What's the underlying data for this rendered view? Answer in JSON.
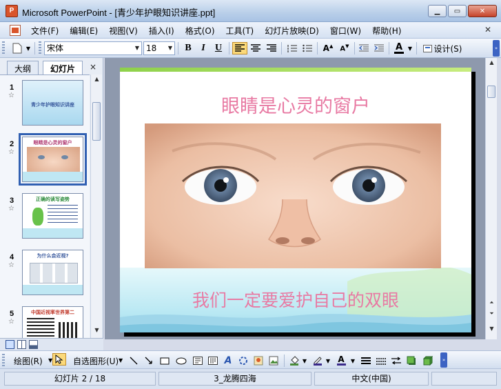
{
  "window": {
    "title": "Microsoft PowerPoint - [青少年护眼知识讲座.ppt]",
    "app_icon": "P"
  },
  "menubar": {
    "items": [
      "文件(F)",
      "编辑(E)",
      "视图(V)",
      "插入(I)",
      "格式(O)",
      "工具(T)",
      "幻灯片放映(D)",
      "窗口(W)",
      "帮助(H)"
    ]
  },
  "toolbar": {
    "font_name": "宋体",
    "font_size": "18",
    "bold": "B",
    "italic": "I",
    "underline": "U",
    "design_label": "设计(S)"
  },
  "leftpanel": {
    "tabs": [
      "大纲",
      "幻灯片"
    ],
    "close": "×",
    "thumbnails": [
      {
        "number": "1",
        "caption": "青少年护眼知识讲座"
      },
      {
        "number": "2",
        "caption": "眼睛是心灵的窗户"
      },
      {
        "number": "3",
        "caption": "正确的读写姿势"
      },
      {
        "number": "4",
        "caption": "为什么会近视?"
      },
      {
        "number": "5",
        "caption": "中国近视率世界第二"
      }
    ]
  },
  "slide": {
    "title": "眼睛是心灵的窗户",
    "subtitle": "我们一定要爱护自己的双眼"
  },
  "drawbar": {
    "draw_label": "绘图(R)",
    "autoshapes_label": "自选图形(U)"
  },
  "statusbar": {
    "slide_info": "幻灯片 2 / 18",
    "design_name": "3_龙腾四海",
    "language": "中文(中国)"
  },
  "colors": {
    "title_pink": "#e87aa3",
    "slide_topline": "#8ed14a",
    "selection": "#3160b2"
  }
}
